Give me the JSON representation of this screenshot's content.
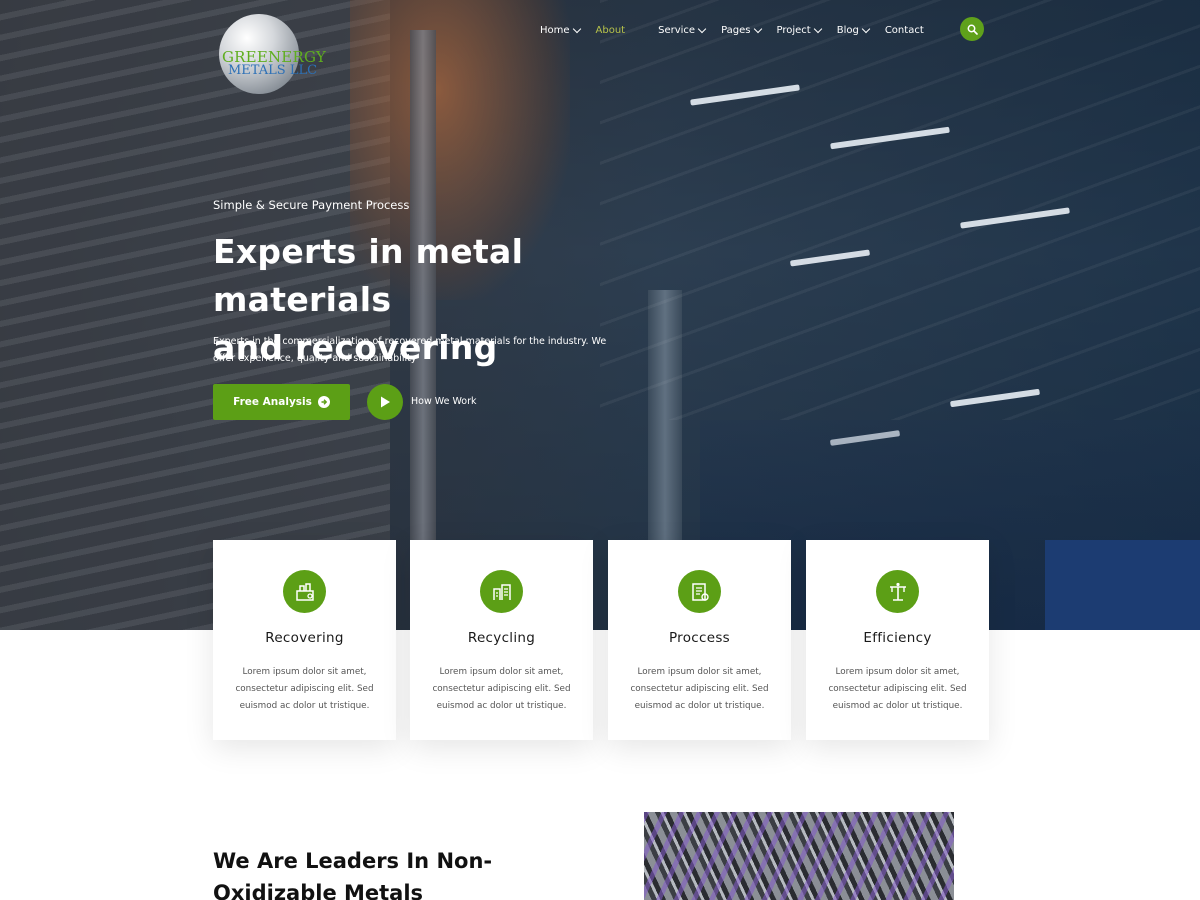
{
  "brand": {
    "line1": "GREENERGY",
    "line2": "METALS LLC"
  },
  "nav": {
    "items": [
      {
        "label": "Home",
        "has_dropdown": true,
        "active": false
      },
      {
        "label": "About",
        "has_dropdown": false,
        "active": true
      },
      {
        "label": "Service",
        "has_dropdown": true,
        "active": false
      },
      {
        "label": "Pages",
        "has_dropdown": true,
        "active": false
      },
      {
        "label": "Project",
        "has_dropdown": true,
        "active": false
      },
      {
        "label": "Blog",
        "has_dropdown": true,
        "active": false
      },
      {
        "label": "Contact",
        "has_dropdown": false,
        "active": false
      }
    ],
    "search_icon": "search-icon"
  },
  "hero": {
    "eyebrow": "Simple & Secure Payment Process",
    "headline_line1": "Experts in metal materials",
    "headline_line2": "and recovering",
    "subtext": "Experts in the commercialization of recovered metal materials for the industry. We offer experience, quality and sustainability",
    "primary_button": "Free Analysis",
    "video_label": "How We Work"
  },
  "features": [
    {
      "title": "Recovering",
      "icon": "recovering-icon",
      "body": "Lorem ipsum dolor sit amet, consectetur adipiscing elit. Sed euismod ac dolor ut tristique."
    },
    {
      "title": "Recycling",
      "icon": "recycling-icon",
      "body": "Lorem ipsum dolor sit amet, consectetur adipiscing elit. Sed euismod ac dolor ut tristique."
    },
    {
      "title": "Proccess",
      "icon": "process-icon",
      "body": "Lorem ipsum dolor sit amet, consectetur adipiscing elit. Sed euismod ac dolor ut tristique."
    },
    {
      "title": "Efficiency",
      "icon": "efficiency-icon",
      "body": "Lorem ipsum dolor sit amet, consectetur adipiscing elit. Sed euismod ac dolor ut tristique."
    }
  ],
  "about": {
    "title_line1": "We Are Leaders In Non-",
    "title_line2": "Oxidizable Metals"
  },
  "colors": {
    "accent": "#5c9f16",
    "active_nav": "#b7c24a"
  }
}
